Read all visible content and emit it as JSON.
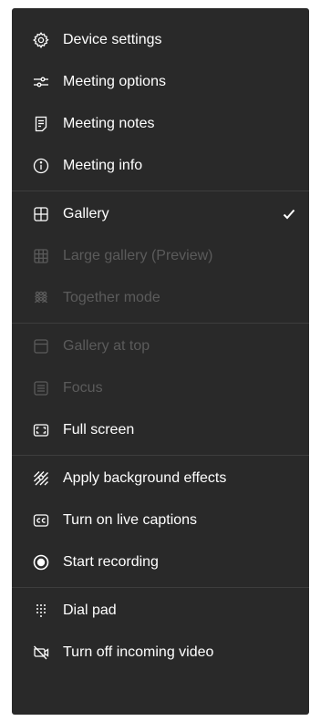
{
  "menu": {
    "groups": [
      {
        "items": [
          {
            "label": "Device settings",
            "icon": "gear-icon",
            "enabled": true
          },
          {
            "label": "Meeting options",
            "icon": "sliders-icon",
            "enabled": true
          },
          {
            "label": "Meeting notes",
            "icon": "notes-icon",
            "enabled": true
          },
          {
            "label": "Meeting info",
            "icon": "info-icon",
            "enabled": true
          }
        ]
      },
      {
        "items": [
          {
            "label": "Gallery",
            "icon": "gallery-icon",
            "enabled": true,
            "selected": true
          },
          {
            "label": "Large gallery (Preview)",
            "icon": "large-gallery-icon",
            "enabled": false
          },
          {
            "label": "Together mode",
            "icon": "together-mode-icon",
            "enabled": false
          }
        ]
      },
      {
        "items": [
          {
            "label": "Gallery at top",
            "icon": "gallery-top-icon",
            "enabled": false
          },
          {
            "label": "Focus",
            "icon": "focus-icon",
            "enabled": false
          },
          {
            "label": "Full screen",
            "icon": "fullscreen-icon",
            "enabled": true
          }
        ]
      },
      {
        "items": [
          {
            "label": "Apply background effects",
            "icon": "background-effects-icon",
            "enabled": true
          },
          {
            "label": "Turn on live captions",
            "icon": "captions-icon",
            "enabled": true
          },
          {
            "label": "Start recording",
            "icon": "record-icon",
            "enabled": true
          }
        ]
      },
      {
        "items": [
          {
            "label": "Dial pad",
            "icon": "dialpad-icon",
            "enabled": true
          },
          {
            "label": "Turn off incoming video",
            "icon": "video-off-icon",
            "enabled": true
          }
        ]
      }
    ]
  },
  "colors": {
    "menu_background": "#292929",
    "text_enabled": "#ffffff",
    "text_disabled": "#5b5b5b",
    "divider": "#3d3d3d"
  }
}
